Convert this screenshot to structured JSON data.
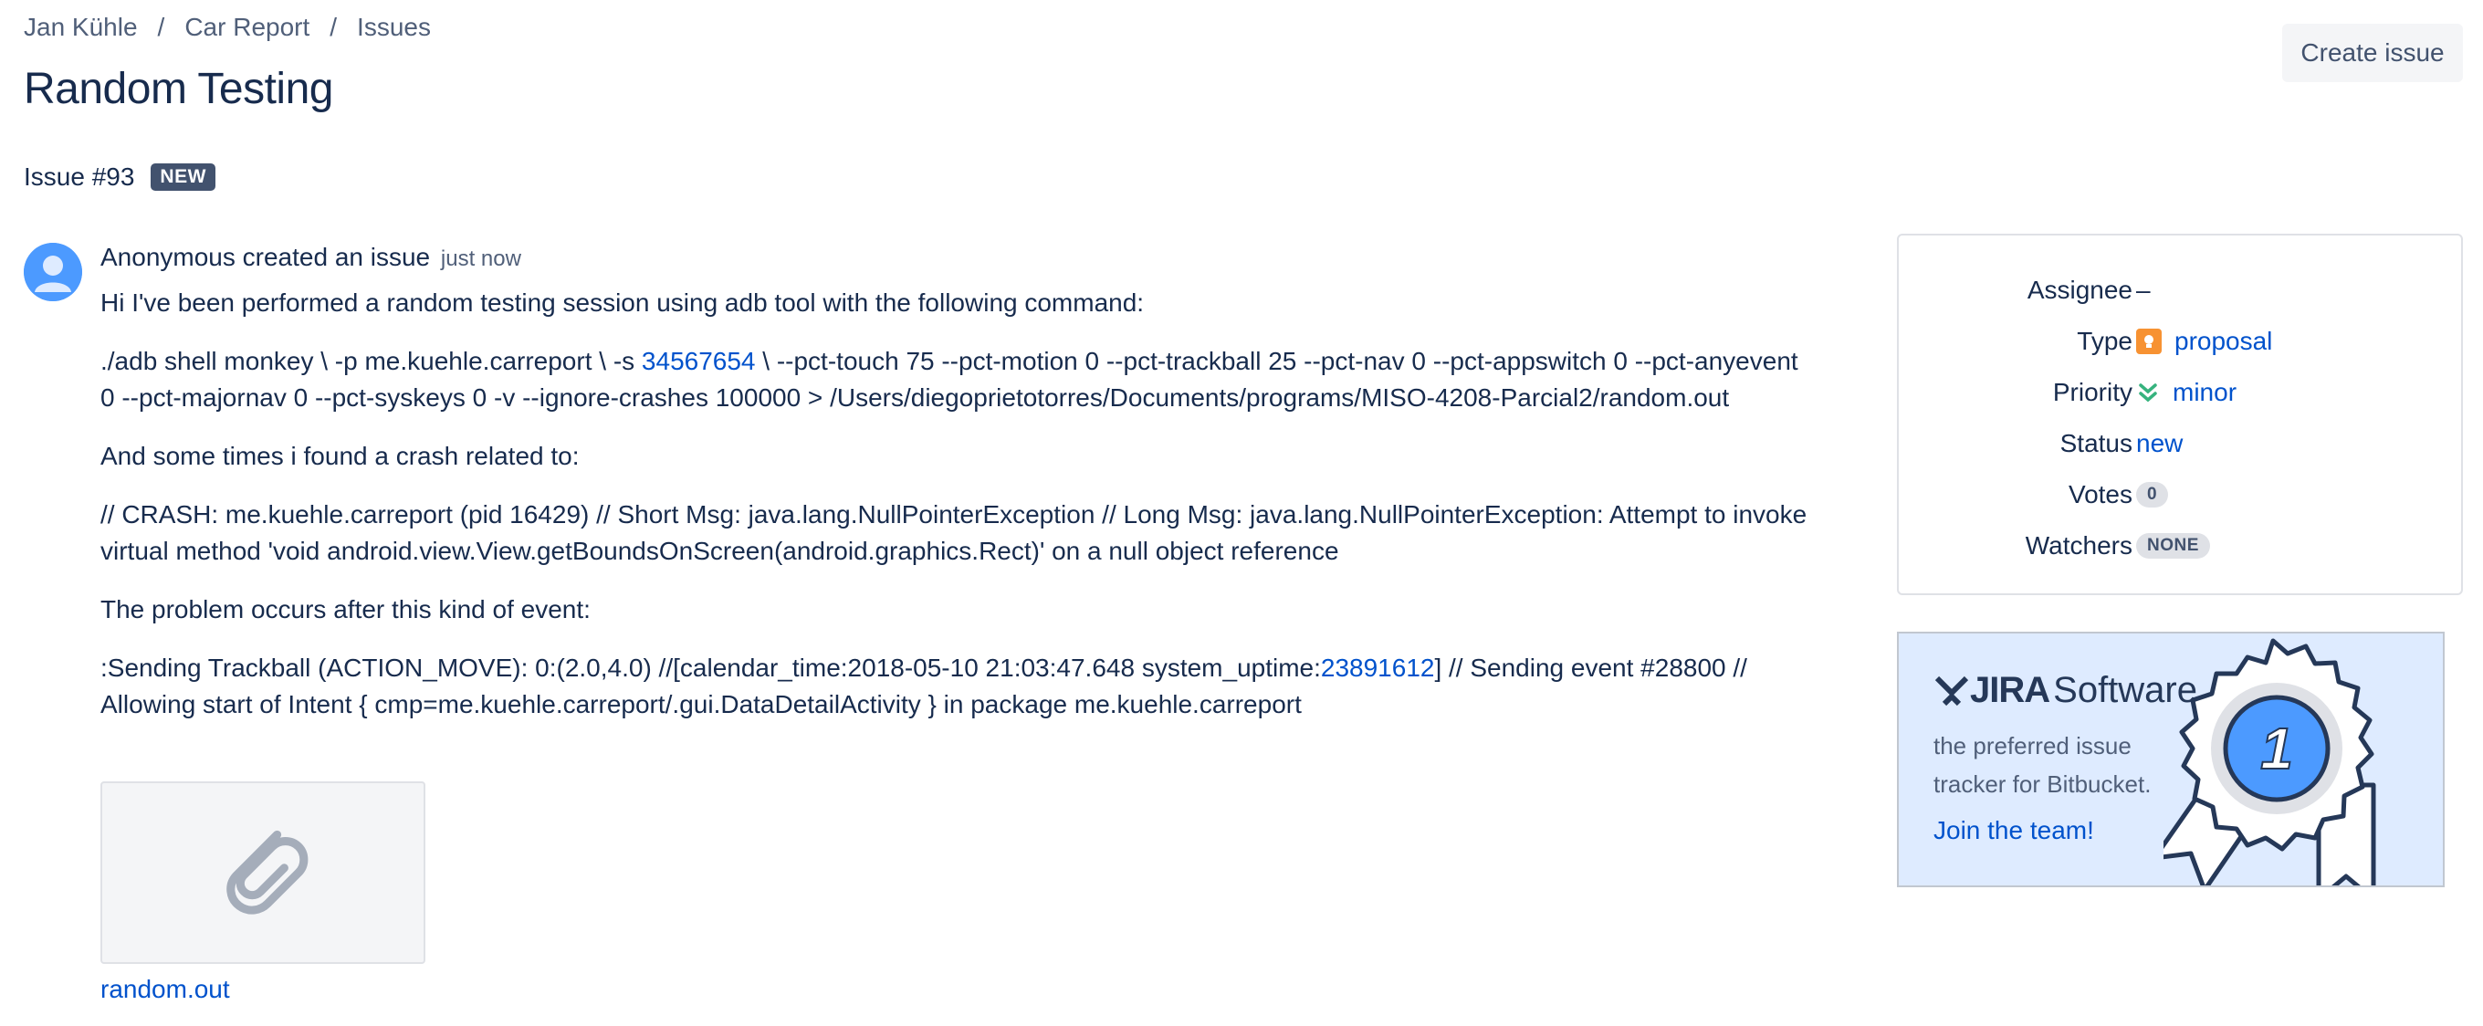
{
  "breadcrumb": {
    "items": [
      "Jan Kühle",
      "Car Report",
      "Issues"
    ],
    "separator": "/"
  },
  "page_title": "Random Testing",
  "create_issue_label": "Create issue",
  "issue": {
    "number_label": "Issue #93",
    "status_badge": "NEW"
  },
  "comment": {
    "author": "Anonymous",
    "action": "created an issue",
    "time": "just now",
    "p1": "Hi I've been performed a random testing session using adb tool with the following command:",
    "p2_pre": "./adb shell monkey \\ -p me.kuehle.carreport \\ -s ",
    "p2_link": "34567654",
    "p2_post": " \\ --pct-touch 75 --pct-motion 0 --pct-trackball 25 --pct-nav 0 --pct-appswitch 0 --pct-anyevent 0 --pct-majornav 0 --pct-syskeys 0 -v --ignore-crashes 100000 > /Users/diegoprietotorres/Documents/programs/MISO-4208-Parcial2/random.out",
    "p3": "And some times i found a crash related to:",
    "p4": "// CRASH: me.kuehle.carreport (pid 16429) // Short Msg: java.lang.NullPointerException // Long Msg: java.lang.NullPointerException: Attempt to invoke virtual method 'void android.view.View.getBoundsOnScreen(android.graphics.Rect)' on a null object reference",
    "p5": "The problem occurs after this kind of event:",
    "p6_pre": ":Sending Trackball (ACTION_MOVE): 0:(2.0,4.0) //[calendar_time:2018-05-10 21:03:47.648 system_uptime:",
    "p6_link": "23891612",
    "p6_post": "] // Sending event #28800 // Allowing start of Intent { cmp=me.kuehle.carreport/.gui.DataDetailActivity } in package me.kuehle.carreport"
  },
  "attachment": {
    "filename": "random.out",
    "icon": "paperclip-icon"
  },
  "details": {
    "assignee_label": "Assignee",
    "assignee_value": "–",
    "type_label": "Type",
    "type_value": "proposal",
    "type_icon": "proposal-icon",
    "priority_label": "Priority",
    "priority_value": "minor",
    "priority_icon": "double-chevron-down-icon",
    "status_label": "Status",
    "status_value": "new",
    "votes_label": "Votes",
    "votes_value": "0",
    "watchers_label": "Watchers",
    "watchers_value": "NONE"
  },
  "promo": {
    "logo_brand": "JIRA",
    "logo_product": "Software",
    "text": "the preferred issue tracker for Bitbucket.",
    "link": "Join the team!",
    "badge_digit": "1"
  },
  "colors": {
    "link": "#0052cc",
    "text": "#172b4d",
    "muted": "#505f79",
    "badge_bg": "#42526e",
    "promo_bg": "#deebff",
    "type_orange": "#f79232",
    "priority_green": "#36b37e"
  }
}
